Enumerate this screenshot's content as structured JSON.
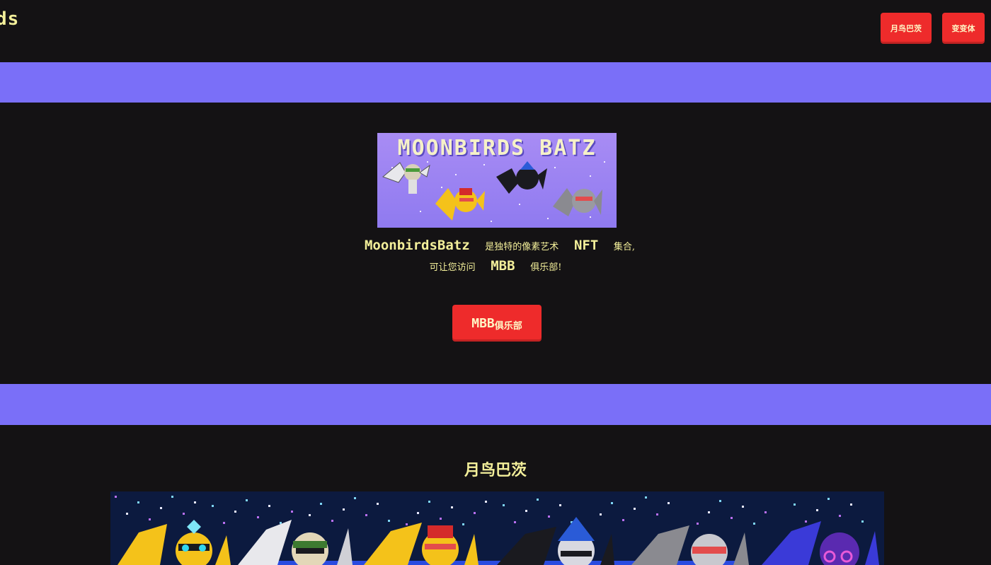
{
  "header": {
    "logo_text": "ds",
    "nav": [
      {
        "label": "月鸟巴茨"
      },
      {
        "label": "变变体"
      }
    ]
  },
  "hero": {
    "banner_title": "MOONBIRDS BATZ",
    "description": {
      "line1_brand": "MoonbirdsBatz",
      "line1_text1": "是独特的像素艺术",
      "line1_nft": "NFT",
      "line1_text2": "集合,",
      "line2_text1": "可让您访问",
      "line2_mbb": "MBB",
      "line2_text2": "俱乐部!"
    },
    "club_button": {
      "bold": "MBB",
      "small": "俱乐部"
    }
  },
  "section": {
    "title": "月鸟巴茨"
  },
  "colors": {
    "background": "#141214",
    "band": "#7a6ff8",
    "accent_red": "#ee2b2b",
    "text_yellow": "#f3ef9a",
    "gallery_bg": "#0c1a3f"
  }
}
